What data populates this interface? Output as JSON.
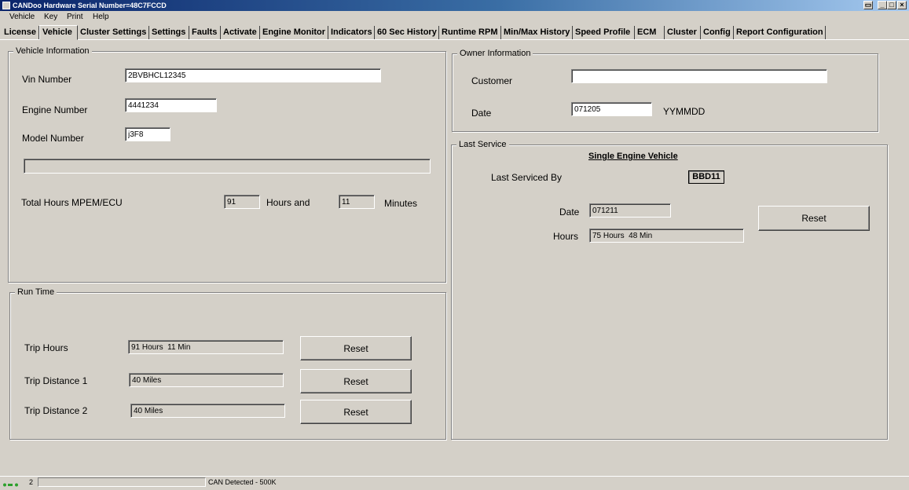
{
  "window": {
    "title": "CANDoo Hardware Serial Number=48C7FCCD"
  },
  "menu": [
    "Vehicle",
    "Key",
    "Print",
    "Help"
  ],
  "tabs": [
    "License",
    "Vehicle",
    "Cluster Settings",
    "Settings",
    "Faults",
    "Activate",
    "Engine Monitor",
    "Indicators",
    "60 Sec History",
    "Runtime RPM",
    "Min/Max History",
    "Speed Profile",
    "ECM",
    "Cluster",
    "Config",
    "Report Configuration"
  ],
  "active_tab": "Vehicle",
  "vehicle_info": {
    "title": "Vehicle Information",
    "vin_label": "Vin Number",
    "vin_value": "2BVBHCL12345",
    "engine_label": "Engine Number",
    "engine_value": "4441234",
    "model_label": "Model Number",
    "model_value": "j3F8",
    "total_hours_label": "Total Hours MPEM/ECU",
    "hours_value": "91",
    "hours_and_label": "Hours and",
    "minutes_value": "11",
    "minutes_label": "Minutes"
  },
  "run_time": {
    "title": "Run Time",
    "trip_hours_label": "Trip Hours",
    "trip_hours_value": "91 Hours  11 Min",
    "trip1_label": "Trip Distance 1",
    "trip1_value": "40 Miles",
    "trip2_label": "Trip Distance 2",
    "trip2_value": "40 Miles",
    "reset_label": "Reset"
  },
  "owner_info": {
    "title": "Owner Information",
    "customer_label": "Customer",
    "customer_value": "",
    "date_label": "Date",
    "date_value": "071205",
    "date_format": "YYMMDD"
  },
  "last_service": {
    "title": "Last Service",
    "heading": "Single Engine Vehicle",
    "serviced_by_label": "Last Serviced By",
    "serviced_by_value": "BBD11",
    "date_label": "Date",
    "date_value": "071211",
    "hours_label": "Hours",
    "hours_value": "75 Hours  48 Min",
    "reset_label": "Reset"
  },
  "status": {
    "count": "2",
    "message": "CAN Detected - 500K"
  }
}
